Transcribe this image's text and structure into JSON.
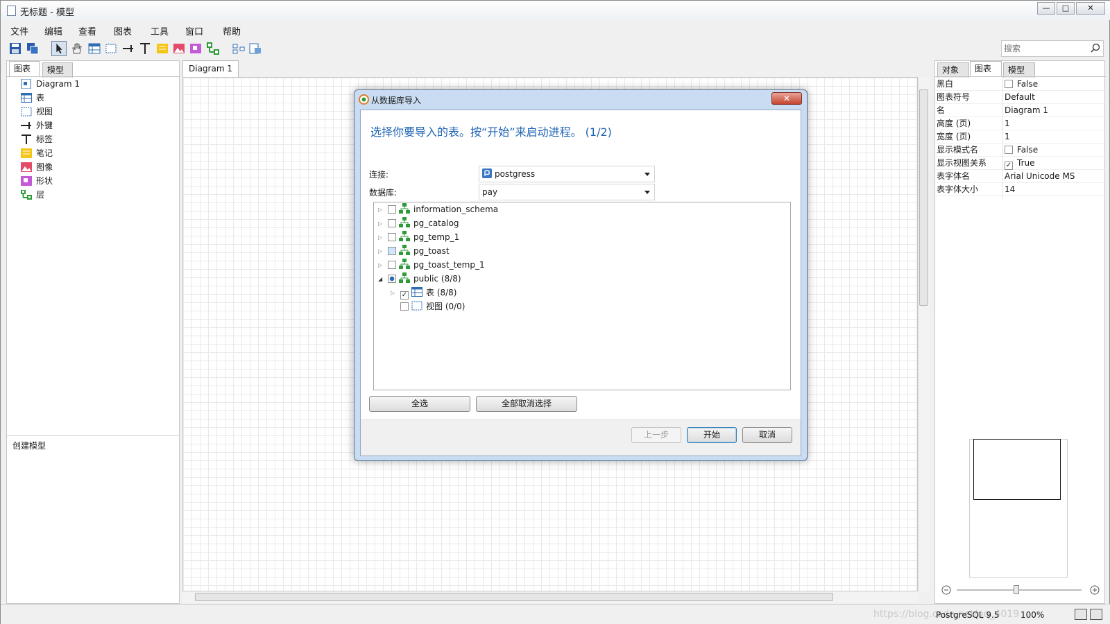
{
  "window": {
    "title": "无标题 - 模型",
    "controls": {
      "minimize": "—",
      "maximize": "□",
      "close": "✕"
    }
  },
  "menu": [
    "文件",
    "编辑",
    "查看",
    "图表",
    "工具",
    "窗口",
    "帮助"
  ],
  "toolbar": {
    "icons": [
      "save-icon",
      "save-all-icon",
      "pointer-icon",
      "hand-icon",
      "table-icon",
      "view-icon",
      "foreign-key-icon",
      "label-icon",
      "note-icon",
      "image-icon",
      "shape-icon",
      "layer-icon",
      "auto-layout-icon",
      "reverse-engineer-icon"
    ],
    "search_placeholder": "搜索"
  },
  "left_panel": {
    "tabs": [
      "图表",
      "模型"
    ],
    "items": [
      {
        "label": "Diagram 1",
        "icon": "diagram-icon"
      },
      {
        "label": "表",
        "icon": "table-icon"
      },
      {
        "label": "视图",
        "icon": "view-icon"
      },
      {
        "label": "外键",
        "icon": "foreign-key-icon"
      },
      {
        "label": "标签",
        "icon": "label-icon"
      },
      {
        "label": "笔记",
        "icon": "note-icon"
      },
      {
        "label": "图像",
        "icon": "image-icon"
      },
      {
        "label": "形状",
        "icon": "shape-icon"
      },
      {
        "label": "层",
        "icon": "layer-icon"
      }
    ],
    "bottom_label": "创建模型"
  },
  "document": {
    "tab": "Diagram 1"
  },
  "right_panel": {
    "tabs": [
      "对象",
      "图表",
      "模型"
    ],
    "properties": [
      {
        "key": "黑白",
        "value": "False",
        "checkbox": true,
        "checked": false
      },
      {
        "key": "图表符号",
        "value": "Default"
      },
      {
        "key": "名",
        "value": "Diagram 1"
      },
      {
        "key": "高度 (页)",
        "value": "1"
      },
      {
        "key": "宽度 (页)",
        "value": "1"
      },
      {
        "key": "显示模式名",
        "value": "False",
        "checkbox": true,
        "checked": false
      },
      {
        "key": "显示视图关系",
        "value": "True",
        "checkbox": true,
        "checked": true
      },
      {
        "key": "表字体名",
        "value": "Arial Unicode MS"
      },
      {
        "key": "表字体大小",
        "value": "14"
      }
    ]
  },
  "status": {
    "db_type": "PostgreSQL 9.5",
    "zoom": "100%",
    "watermark": "https://blog.csdn.net/qq_4019"
  },
  "dialog": {
    "title": "从数据库导入",
    "close": "✕",
    "heading": "选择你要导入的表。按“开始”来启动进程。 (1/2)",
    "connection_label": "连接:",
    "connection_value": "postgress",
    "database_label": "数据库:",
    "database_value": "pay",
    "tree": [
      {
        "label": "information_schema",
        "state": "unchecked",
        "expander": "collapsed",
        "level": 0
      },
      {
        "label": "pg_catalog",
        "state": "unchecked",
        "expander": "collapsed",
        "level": 0
      },
      {
        "label": "pg_temp_1",
        "state": "unchecked",
        "expander": "collapsed",
        "level": 0
      },
      {
        "label": "pg_toast",
        "state": "unchecked",
        "expander": "collapsed",
        "level": 0
      },
      {
        "label": "pg_toast_temp_1",
        "state": "unchecked",
        "expander": "collapsed",
        "level": 0
      },
      {
        "label": "public (8/8)",
        "state": "partial",
        "expander": "expanded",
        "level": 0
      },
      {
        "label": "表 (8/8)",
        "state": "checked",
        "expander": "collapsed",
        "level": 1
      },
      {
        "label": "视图 (0/0)",
        "state": "unchecked",
        "expander": "none",
        "level": 1
      }
    ],
    "select_all": "全选",
    "deselect_all": "全部取消选择",
    "back": "上一步",
    "start": "开始",
    "cancel": "取消"
  }
}
